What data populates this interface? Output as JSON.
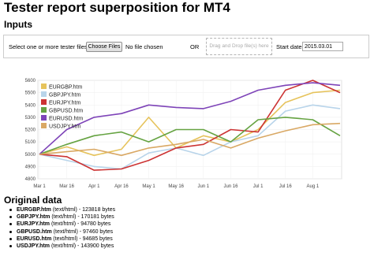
{
  "page": {
    "title": "Tester report superposition for MT4"
  },
  "inputs": {
    "heading": "Inputs",
    "select_label": "Select one or more tester files:",
    "choose_button": "Choose Files",
    "no_file_text": "No file chosen",
    "or_text": "OR",
    "drop_text": "Drag and Drop file(s) here",
    "start_date_label": "Start date:",
    "start_date_value": "2015.03.01"
  },
  "chart_data": {
    "type": "line",
    "x_ticks": [
      "Mar 1",
      "Mar 16",
      "Apr 1",
      "Apr 16",
      "May 1",
      "May 16",
      "Jun 1",
      "Jun 16",
      "Jul 1",
      "Jul 16",
      "Aug 1"
    ],
    "x": [
      "Mar 1",
      "Mar 16",
      "Apr 1",
      "Apr 16",
      "May 1",
      "May 16",
      "Jun 1",
      "Jun 16",
      "Jul 1",
      "Jul 16",
      "Aug 1",
      "Aug 10"
    ],
    "ylim": [
      4800,
      5600
    ],
    "y_ticks": [
      4800,
      4900,
      5000,
      5100,
      5200,
      5300,
      5400,
      5500,
      5600
    ],
    "grid": true,
    "legend_position": "top-left",
    "series": [
      {
        "name": "EURGBP.htm",
        "color": "#e6c35c",
        "values": [
          5000,
          5060,
          4990,
          5040,
          5300,
          5050,
          5150,
          5100,
          5200,
          5420,
          5500,
          5520
        ]
      },
      {
        "name": "GBPJPY.htm",
        "color": "#b8d4ea",
        "values": [
          5000,
          4950,
          4900,
          4880,
          5010,
          5050,
          4990,
          5100,
          5150,
          5350,
          5400,
          5370
        ]
      },
      {
        "name": "EURJPY.htm",
        "color": "#cc3333",
        "values": [
          5000,
          4980,
          4870,
          4880,
          4950,
          5050,
          5080,
          5200,
          5180,
          5520,
          5600,
          5500
        ]
      },
      {
        "name": "GBPUSD.htm",
        "color": "#66a342",
        "values": [
          5000,
          5080,
          5150,
          5180,
          5100,
          5200,
          5200,
          5100,
          5280,
          5300,
          5280,
          5150
        ]
      },
      {
        "name": "EURUSD.htm",
        "color": "#7e44b8",
        "values": [
          5000,
          5200,
          5300,
          5330,
          5400,
          5380,
          5370,
          5430,
          5520,
          5560,
          5580,
          5560
        ]
      },
      {
        "name": "USDJPY.htm",
        "color": "#d9a864",
        "values": [
          5000,
          5020,
          5040,
          4990,
          5050,
          5080,
          5120,
          5050,
          5130,
          5190,
          5240,
          5250
        ]
      }
    ]
  },
  "original": {
    "heading": "Original data",
    "files": [
      {
        "name": "EURGBP.htm",
        "detail": " (text/html) - 123818 bytes"
      },
      {
        "name": "GBPJPY.htm",
        "detail": " (text/html) - 170181 bytes"
      },
      {
        "name": "EURJPY.htm",
        "detail": " (text/html) - 94780 bytes"
      },
      {
        "name": "GBPUSD.htm",
        "detail": " (text/html) - 97460 bytes"
      },
      {
        "name": "EURUSD.htm",
        "detail": " (text/html) - 94685 bytes"
      },
      {
        "name": "USDJPY.htm",
        "detail": " (text/html) - 143900 bytes"
      }
    ]
  }
}
